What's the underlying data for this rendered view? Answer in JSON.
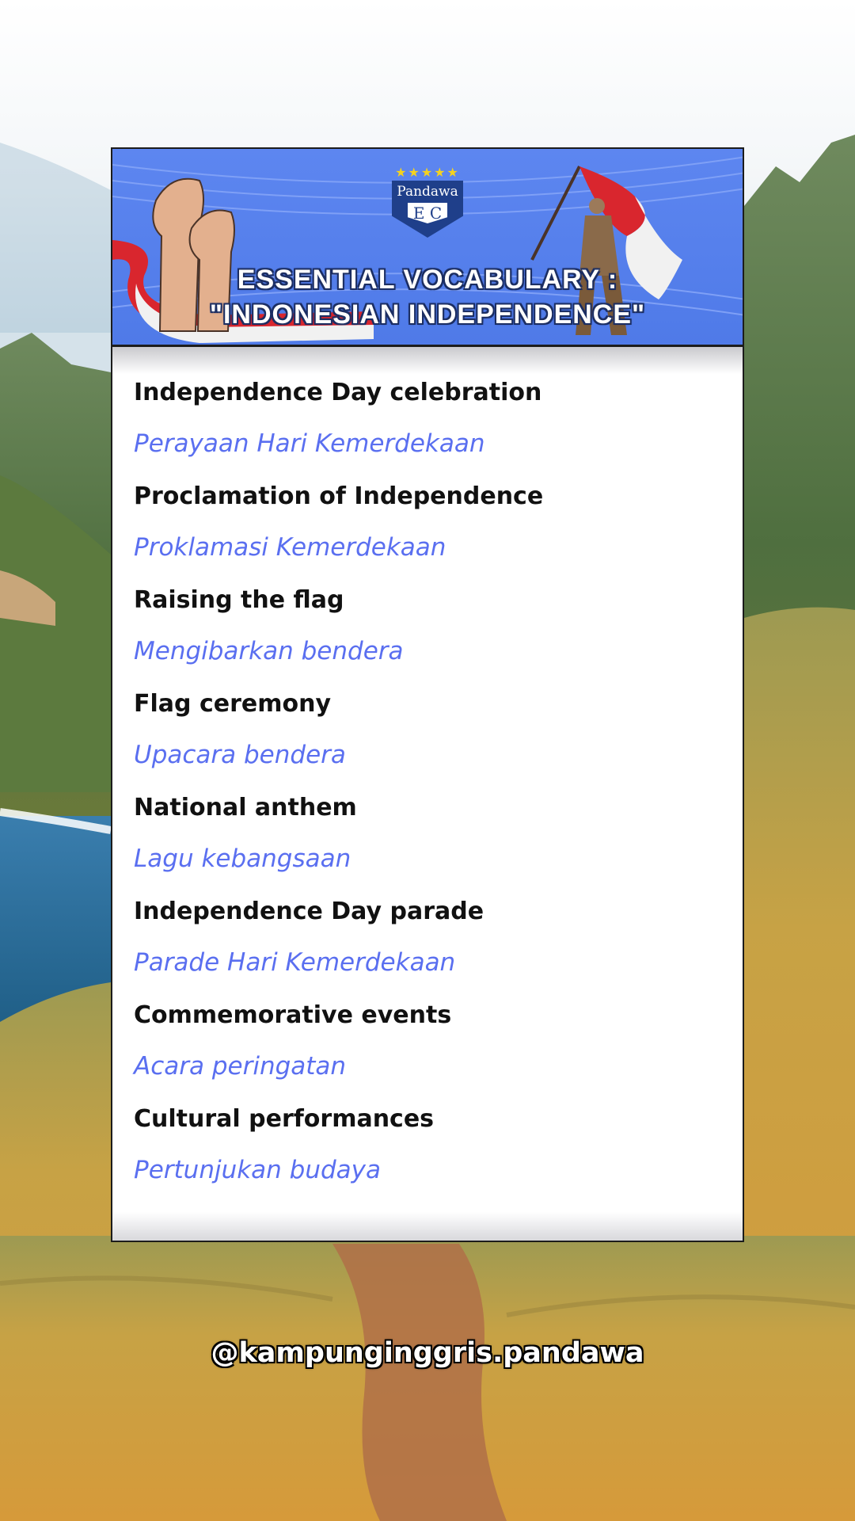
{
  "banner": {
    "logo_text": "Pandawa",
    "logo_letters": "E C",
    "logo_stars": "★★★★★",
    "title_line1": "ESSENTIAL VOCABULARY :",
    "title_line2": "\"INDONESIAN INDEPENDENCE\""
  },
  "vocabulary": [
    {
      "english": "Independence Day celebration",
      "indonesian": "Perayaan Hari Kemerdekaan"
    },
    {
      "english": "Proclamation of Independence",
      "indonesian": "Proklamasi Kemerdekaan"
    },
    {
      "english": "Raising the flag",
      "indonesian": "Mengibarkan bendera"
    },
    {
      "english": "Flag ceremony",
      "indonesian": "Upacara bendera"
    },
    {
      "english": "National anthem",
      "indonesian": "Lagu kebangsaan"
    },
    {
      "english": "Independence Day parade",
      "indonesian": "Parade Hari Kemerdekaan"
    },
    {
      "english": "Commemorative events",
      "indonesian": "Acara peringatan"
    },
    {
      "english": "Cultural performances",
      "indonesian": "Pertunjukan budaya"
    }
  ],
  "footer": {
    "handle": "@kampunginggris.pandawa"
  },
  "colors": {
    "banner_blue": "#5d86f0",
    "translation_blue": "#5a6ff0",
    "english_text": "#111111",
    "flag_red": "#d9262e"
  }
}
